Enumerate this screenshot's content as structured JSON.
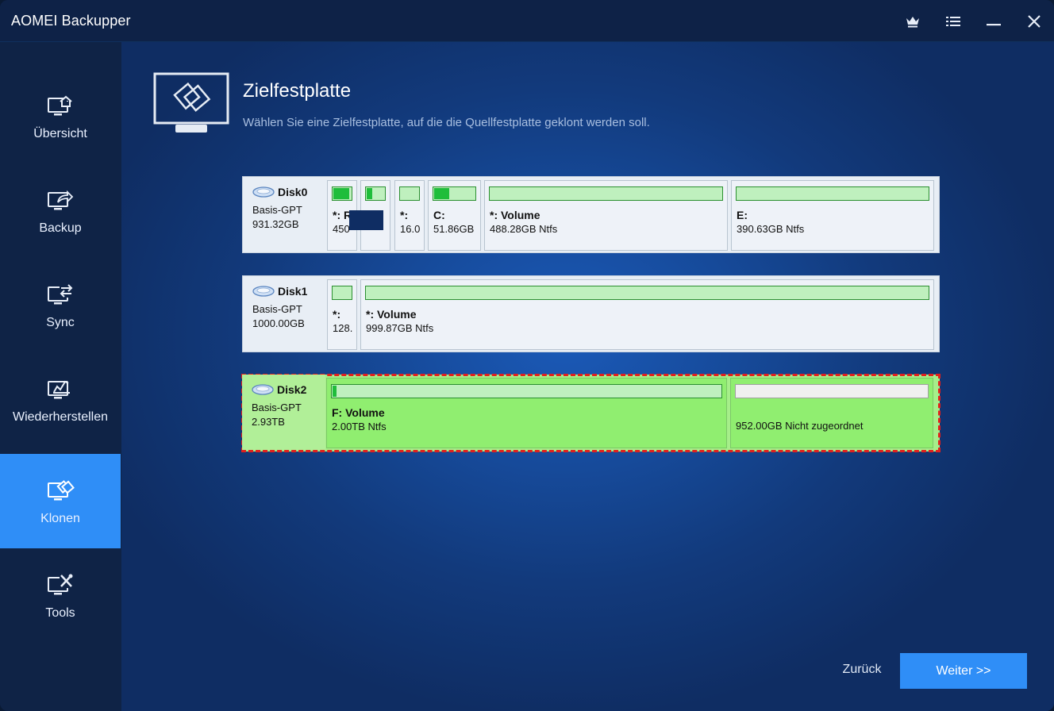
{
  "window": {
    "title": "AOMEI Backupper"
  },
  "titlebar": {
    "icons": [
      "crown-icon",
      "menu-icon",
      "minimize-icon",
      "close-icon"
    ]
  },
  "sidebar": {
    "items": [
      {
        "label": "Übersicht",
        "icon": "monitor-home-icon",
        "active": false
      },
      {
        "label": "Backup",
        "icon": "monitor-share-icon",
        "active": false
      },
      {
        "label": "Sync",
        "icon": "monitor-sync-icon",
        "active": false
      },
      {
        "label": "Wiederherstellen",
        "icon": "monitor-restore-icon",
        "active": false
      },
      {
        "label": "Klonen",
        "icon": "monitor-clone-icon",
        "active": true
      },
      {
        "label": "Tools",
        "icon": "monitor-tools-icon",
        "active": false
      }
    ]
  },
  "header": {
    "title": "Zielfestplatte",
    "subtitle": "Wählen Sie eine Zielfestplatte, auf die die Quellfestplatte geklont werden soll.",
    "icon": "clone-disk-icon"
  },
  "disks": [
    {
      "name": "Disk0",
      "type": "Basis-GPT",
      "size": "931.32GB",
      "selected": false,
      "partitions": [
        {
          "name": "*: R",
          "size": "450",
          "used": 0.85
        },
        {
          "name": "*:",
          "size": "",
          "used": 0.25
        },
        {
          "name": "*:",
          "size": "16.0",
          "used": 0.0
        },
        {
          "name": "C:",
          "size": "51.86GB",
          "used": 0.35
        },
        {
          "name": "*: Volume",
          "size": "488.28GB Ntfs",
          "used": 0.0
        },
        {
          "name": "E:",
          "size": "390.63GB Ntfs",
          "used": 0.0
        }
      ]
    },
    {
      "name": "Disk1",
      "type": "Basis-GPT",
      "size": "1000.00GB",
      "selected": false,
      "partitions": [
        {
          "name": "*:",
          "size": "128.",
          "used": 0.0
        },
        {
          "name": "*: Volume",
          "size": "999.87GB Ntfs",
          "used": 0.0
        }
      ]
    },
    {
      "name": "Disk2",
      "type": "Basis-GPT",
      "size": "2.93TB",
      "selected": true,
      "partitions": [
        {
          "name": "F: Volume",
          "size": "2.00TB Ntfs",
          "used": 0.01
        },
        {
          "name": "",
          "size": "952.00GB Nicht zugeordnet",
          "used": 0.0,
          "unallocated": true
        }
      ]
    }
  ],
  "footer": {
    "back_label": "Zurück",
    "next_label": "Weiter >>"
  },
  "colors": {
    "accent": "#2f8ef7",
    "selection_outline": "#e2201d",
    "selected_disk": "#a6ee8a",
    "partition_fill": "#1fbd3b"
  }
}
